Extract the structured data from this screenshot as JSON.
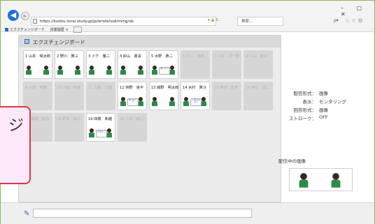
{
  "browser": {
    "url": "https://kudou.local.study.jp/jp/wrote/ssdrming/sb",
    "search_placeholder": "検索...",
    "tab_label": "エクスチェンジボード",
    "tab2_label": "授業履歴",
    "window_controls": "– ▢ ✕",
    "search_glyph": "ρ▾",
    "star_icons": "☆☆⚙",
    "addr_tools": "▾ 🔒 C"
  },
  "board": {
    "title": "エクスチェンジボード",
    "cells": [
      {
        "name": "1 山本　晴太郎",
        "state": "active",
        "note": ""
      },
      {
        "name": "2 野川　賢三",
        "state": "active",
        "note": ""
      },
      {
        "name": "3 小下　優二",
        "state": "active",
        "note": ""
      },
      {
        "name": "4 鈴山　勇喜",
        "state": "active",
        "note": ""
      },
      {
        "name": "5 水野　貴二",
        "state": "active",
        "note": "あいさつ"
      },
      {
        "name": "6 生山　健和",
        "state": "empty",
        "note": ""
      },
      {
        "name": "7 山本　洋一郎",
        "state": "empty",
        "note": ""
      },
      {
        "name": "8 小山　健太",
        "state": "empty",
        "note": ""
      },
      {
        "name": "9 川田　秀雄",
        "state": "empty",
        "note": ""
      },
      {
        "name": "10 三輪　和雄",
        "state": "empty",
        "note": ""
      },
      {
        "name": "11 古橋　洋雄",
        "state": "empty",
        "note": ""
      },
      {
        "name": "12 林野　良平",
        "state": "active",
        "note": "ありがとう"
      },
      {
        "name": "13 紺野　明太郎",
        "state": "active",
        "note": ""
      },
      {
        "name": "14 木村　賢斗",
        "state": "active",
        "note": "ごめんなさい"
      },
      {
        "name": "15 西崎　正男",
        "state": "empty",
        "note": ""
      },
      {
        "name": "16 伊豆　健二",
        "state": "empty",
        "note": ""
      },
      {
        "name": "17 細部　健治",
        "state": "empty",
        "note": ""
      },
      {
        "name": "18 野本　陽介",
        "state": "empty",
        "note": ""
      },
      {
        "name": "19 四橋　和雄",
        "state": "active",
        "note": "おはよう"
      },
      {
        "name": "20 小林　健二",
        "state": "empty",
        "note": ""
      }
    ]
  },
  "info": {
    "delivery_label": "配信形式：",
    "delivery_value": "画像",
    "display_label": "表示：",
    "display_value": "センタリング",
    "answer_label": "回答形式：",
    "answer_value": "画像",
    "stroke_label": "ストローク：",
    "stroke_value": "OFF"
  },
  "preview": {
    "label": "配信中の画像"
  },
  "overlay": {
    "text": "ジ"
  },
  "comment": {
    "placeholder": ""
  }
}
